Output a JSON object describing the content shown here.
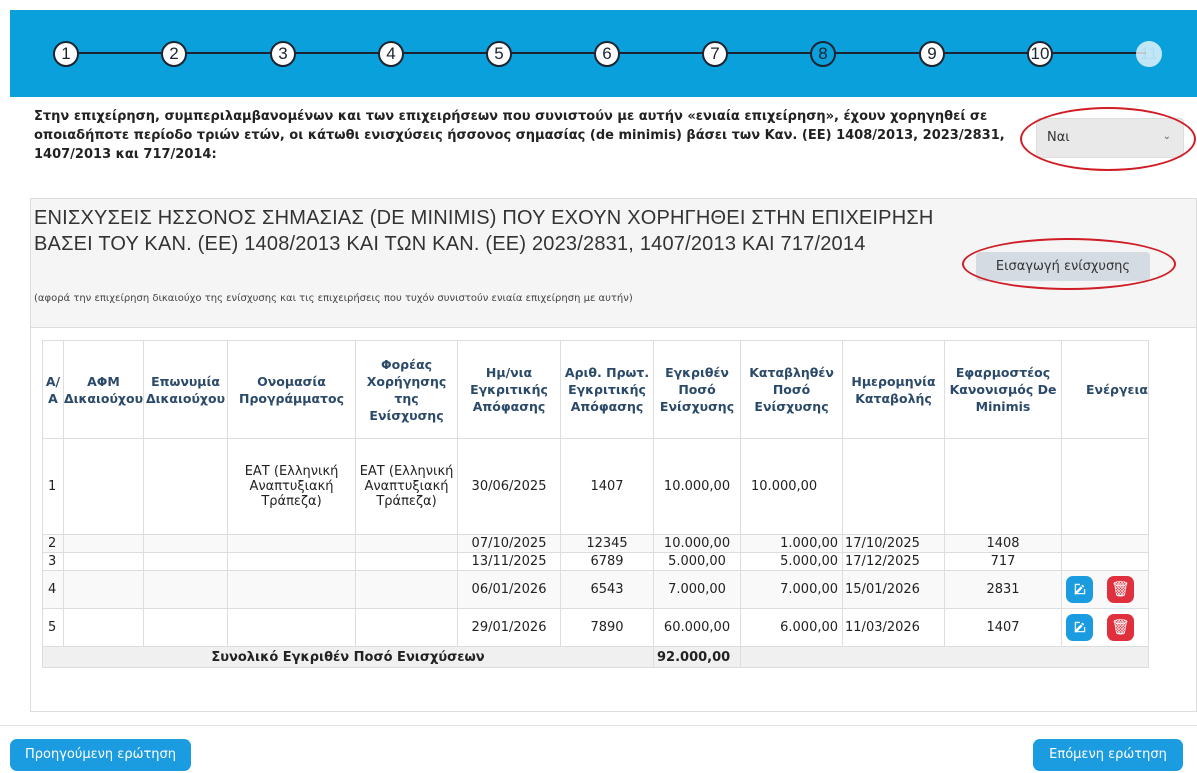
{
  "stepper": {
    "steps": [
      "1",
      "2",
      "3",
      "4",
      "5",
      "6",
      "7",
      "8",
      "9",
      "10",
      "11"
    ],
    "current": "8",
    "colors": {
      "bar": "#0aa0dc",
      "circle": "#ffffff",
      "line": "#1c2430"
    }
  },
  "question": {
    "text": "Στην επιχείρηση, συμπεριλαμβανομένων και των επιχειρήσεων που συνιστούν με αυτήν «ενιαία επιχείρηση», έχουν χορηγηθεί σε οποιαδήποτε περίοδο τριών ετών, οι κάτωθι ενισχύσεις ήσσονος σημασίας (de minimis) βάσει των Καν. (ΕΕ) 1408/2013, 2023/2831, 1407/2013 και 717/2014:",
    "answer": "Ναι",
    "answer_icon": "chevron-down-icon"
  },
  "panel": {
    "title": "ΕΝΙΣΧΥΣΕΙΣ ΗΣΣΟΝΟΣ ΣΗΜΑΣΙΑΣ (DE MINIMIS) ΠΟΥ ΕΧΟΥΝ ΧΟΡΗΓΗΘΕΙ ΣΤΗΝ ΕΠΙΧΕΙΡΗΣΗ ΒΑΣΕΙ ΤΟΥ ΚΑΝ. (ΕΕ) 1408/2013 ΚΑΙ ΤΩΝ ΚΑΝ. (ΕΕ) 2023/2831, 1407/2013 ΚΑΙ 717/2014",
    "subtitle": "(αφορά την επιχείρηση δικαιούχο της ενίσχυσης και τις επιχειρήσεις που τυχόν συνιστούν ενιαία επιχείρηση με αυτήν)",
    "add_button": "Εισαγωγή ενίσχυσης"
  },
  "table": {
    "headers": {
      "aa": "Α/Α",
      "afm": "ΑΦΜ Δικαιούχου",
      "name": "Επωνυμία Δικαιούχου",
      "program": "Ονομασία Προγράμματος",
      "agency": "Φορέας Χορήγησης της Ενίσχυσης",
      "decision_date": "Ημ/νια Εγκριτικής Απόφασης",
      "protocol": "Αριθ. Πρωτ. Εγκριτικής Απόφασης",
      "approved": "Εγκριθέν Ποσό Ενίσχυσης",
      "paid": "Καταβληθέν Ποσό Ενίσχυσης",
      "pay_date": "Ημερομηνία Καταβολής",
      "regulation": "Εφαρμοστέος Κανονισμός De Minimis",
      "actions": "Ενέργεια"
    },
    "rows": [
      {
        "aa": "1",
        "afm": "",
        "name": "",
        "program": "ΕΑΤ (Ελληνική Αναπτυξιακή Τράπεζα)",
        "agency": "ΕΑΤ (Ελληνική Αναπτυξιακή Τράπεζα)",
        "decision_date": "30/06/2025",
        "protocol": "1407",
        "approved": "10.000,00",
        "paid": "10.000,00",
        "pay_date": "",
        "regulation": ""
      },
      {
        "aa": "2",
        "afm": "",
        "name": "",
        "program": "",
        "agency": "",
        "decision_date": "07/10/2025",
        "protocol": "12345",
        "approved": "10.000,00",
        "paid": "1.000,00",
        "pay_date": "17/10/2025",
        "regulation": "1408"
      },
      {
        "aa": "3",
        "afm": "",
        "name": "",
        "program": "",
        "agency": "",
        "decision_date": "13/11/2025",
        "protocol": "6789",
        "approved": "5.000,00",
        "paid": "5.000,00",
        "pay_date": "17/12/2025",
        "regulation": "717"
      },
      {
        "aa": "4",
        "afm": "",
        "name": "",
        "program": "",
        "agency": "",
        "decision_date": "06/01/2026",
        "protocol": "6543",
        "approved": "7.000,00",
        "paid": "7.000,00",
        "pay_date": "15/01/2026",
        "regulation": "2831"
      },
      {
        "aa": "5",
        "afm": "",
        "name": "",
        "program": "",
        "agency": "",
        "decision_date": "29/01/2026",
        "protocol": "7890",
        "approved": "60.000,00",
        "paid": "6.000,00",
        "pay_date": "11/03/2026",
        "regulation": "1407"
      }
    ],
    "total_label": "Συνολικό Εγκριθέν Ποσό Ενισχύσεων",
    "total_value": "92.000,00",
    "action_icons": [
      "edit-icon",
      "trash-icon"
    ],
    "colors": {
      "edit": "#1b9be0",
      "delete": "#e0303d",
      "header_text": "#2b4a6a"
    }
  },
  "footer": {
    "prev": "Προηγούμενη ερώτηση",
    "next": "Επόμενη ερώτηση"
  }
}
